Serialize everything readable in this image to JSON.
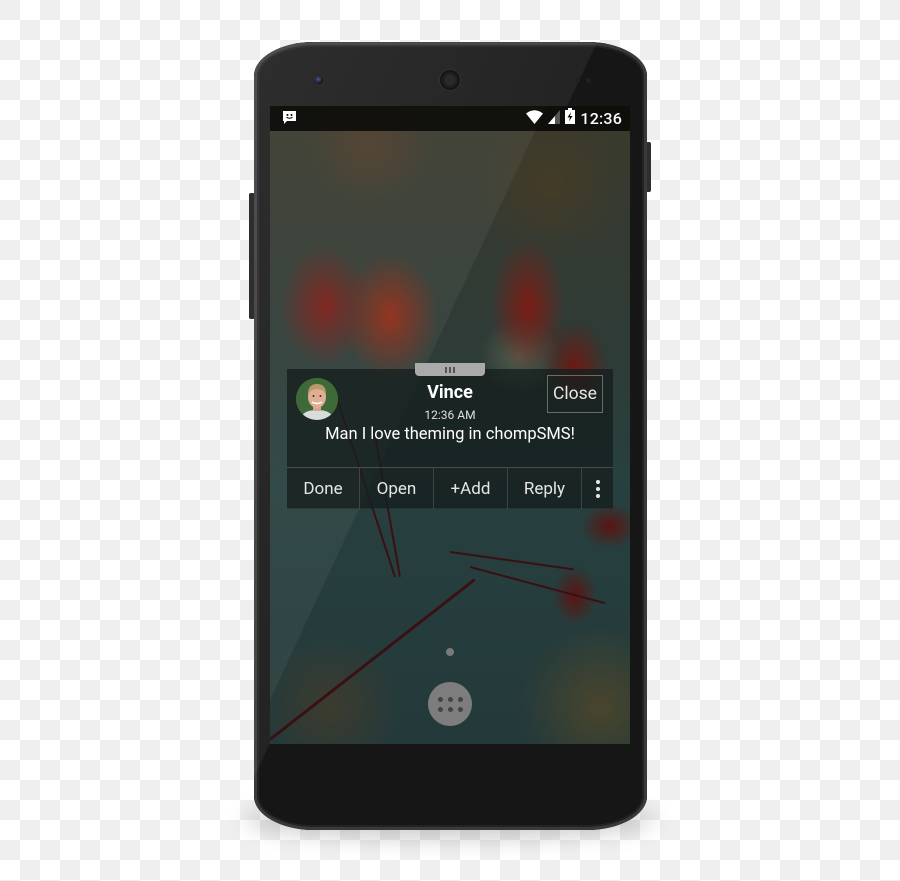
{
  "status_bar": {
    "notification_icon": "chat-smiley-icon",
    "wifi_icon": "wifi-icon",
    "signal_icon": "cell-signal-icon",
    "battery_icon": "battery-charging-icon",
    "time": "12:36"
  },
  "notification_popup": {
    "avatar": "contact-avatar",
    "contact_name": "Vince",
    "time": "12:36 AM",
    "message": "Man I love theming in chompSMS!",
    "close_label": "Close",
    "actions": [
      {
        "label": "Done"
      },
      {
        "label": "Open"
      },
      {
        "label": "+Add"
      },
      {
        "label": "Reply"
      }
    ],
    "overflow_icon": "more-vert-icon"
  },
  "home": {
    "page_indicator": "page-dot",
    "app_drawer_icon": "app-drawer-icon"
  },
  "colors": {
    "popup_background": "#141c1a",
    "text_primary": "#ffffff",
    "phone_body": "#161616"
  }
}
